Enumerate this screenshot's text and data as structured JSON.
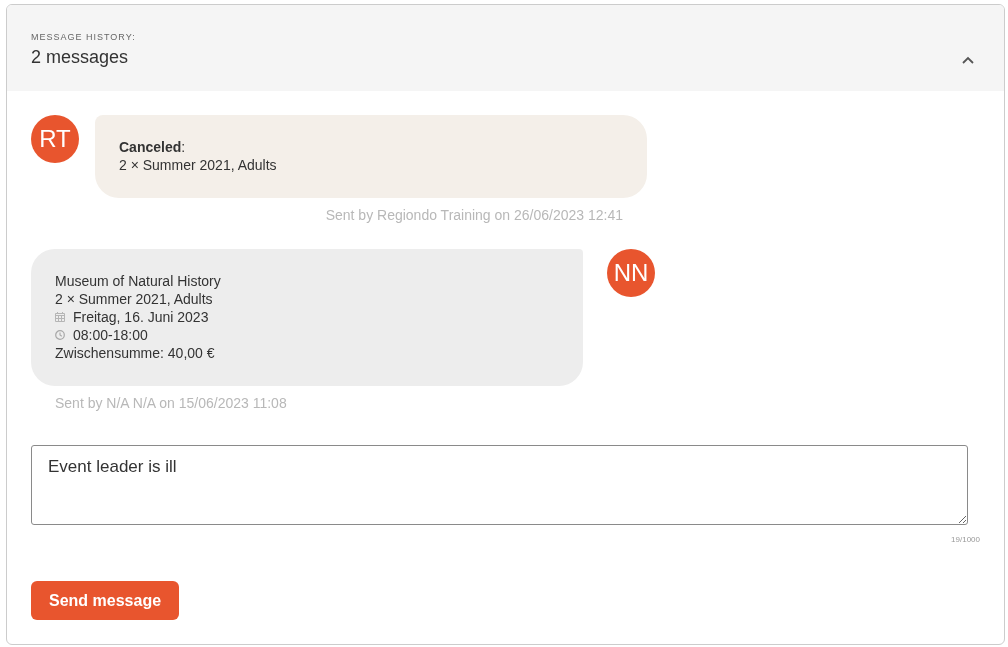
{
  "history": {
    "label": "MESSAGE HISTORY:",
    "count": "2 messages",
    "expanded": true
  },
  "messages": [
    {
      "kind": "staff",
      "initials": "RT",
      "lines": [
        {
          "kind": "text",
          "text": "**Canceled**:"
        },
        {
          "kind": "text",
          "text": "2 × Summer 2021, Adults"
        }
      ],
      "meta": "Sent by Regiondo Training on 26/06/2023 12:41"
    },
    {
      "kind": "customer",
      "initials": "NN",
      "lines": [
        {
          "kind": "text",
          "text": "Museum of Natural History"
        },
        {
          "kind": "text",
          "text": "2 × Summer 2021, Adults"
        },
        {
          "kind": "date",
          "text": "Freitag, 16. Juni 2023"
        },
        {
          "kind": "time",
          "text": "08:00-18:00"
        },
        {
          "kind": "text",
          "text": "Zwischensumme: 40,00 €"
        }
      ],
      "meta": "Sent by N/A N/A on 15/06/2023 11:08"
    }
  ],
  "composer": {
    "value": "Event leader is ill",
    "counter": "19/1000"
  },
  "send_button": "Send message"
}
